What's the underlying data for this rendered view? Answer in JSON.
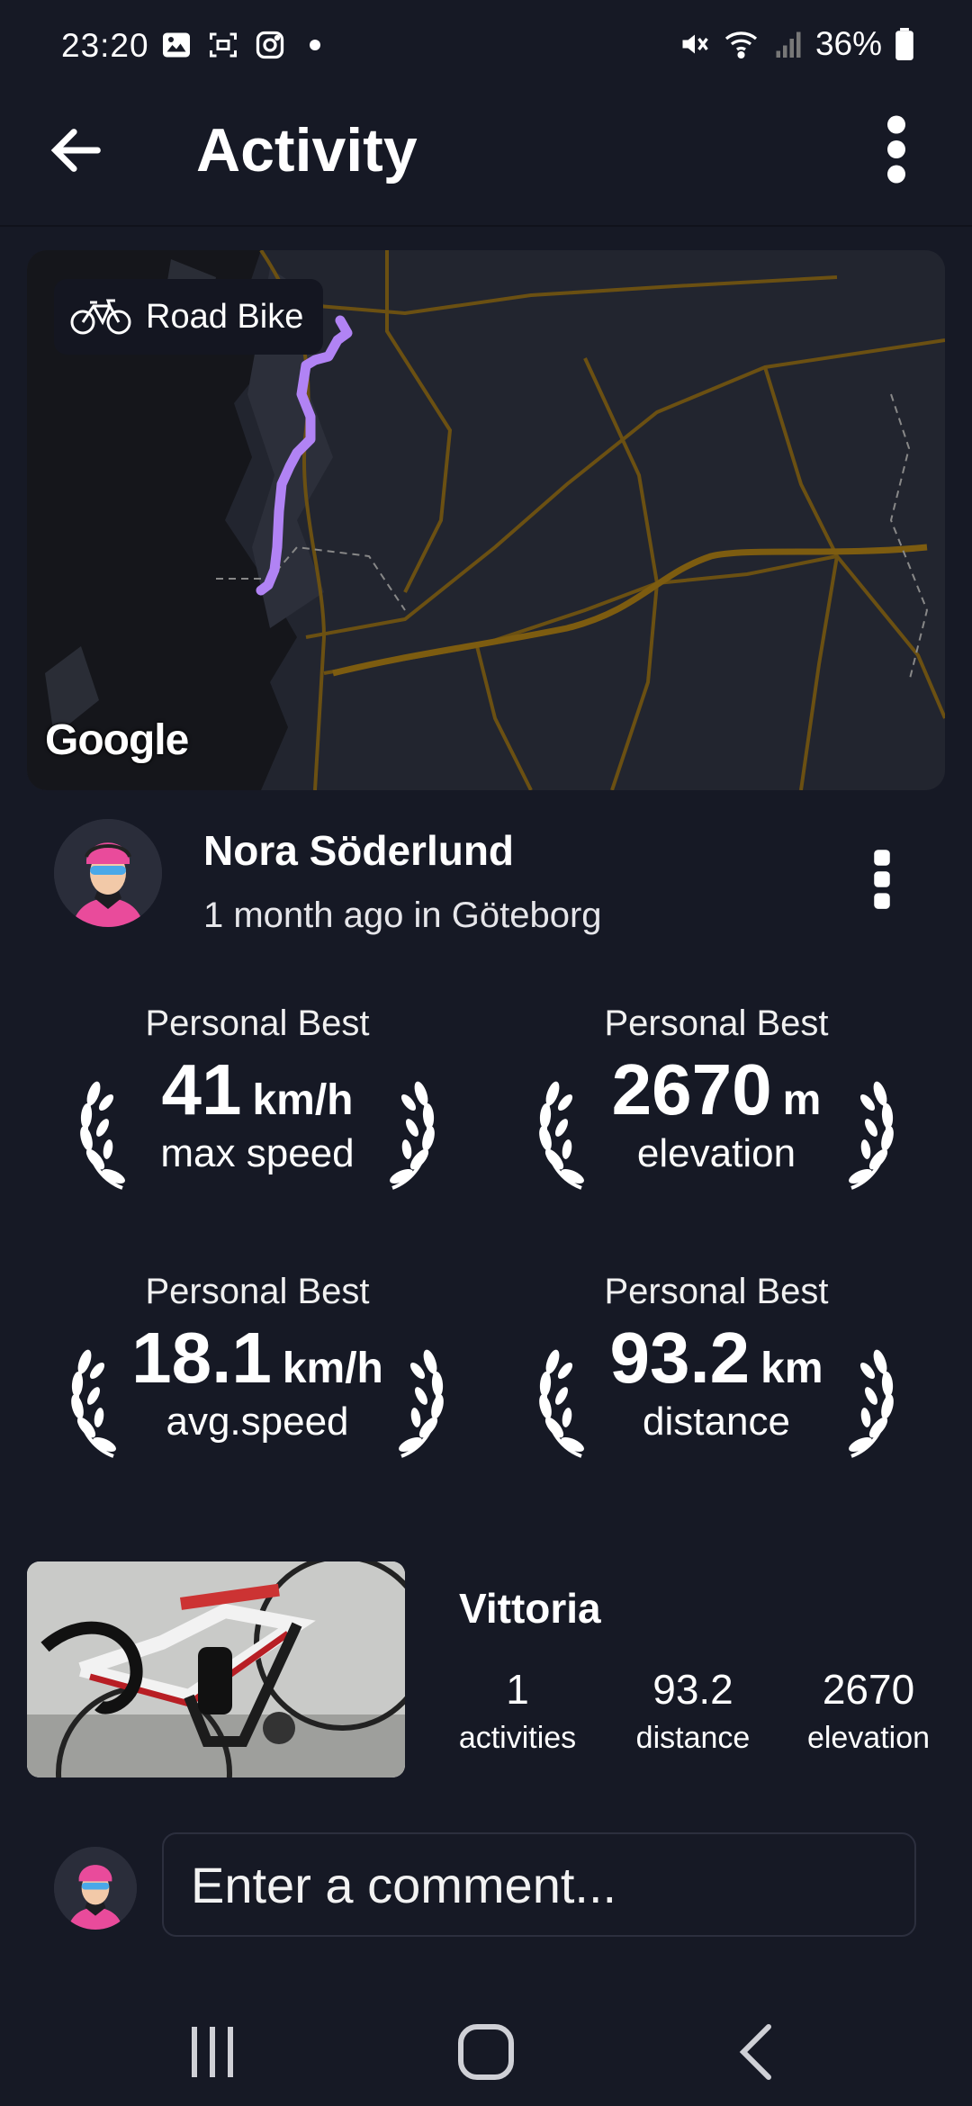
{
  "status": {
    "time": "23:20",
    "battery": "36%"
  },
  "appbar": {
    "title": "Activity"
  },
  "map": {
    "activity_type": "Road Bike",
    "provider": "Google",
    "route_color": "#b183f4"
  },
  "user": {
    "name": "Nora Söderlund",
    "subtitle": "1 month ago in Göteborg"
  },
  "stats": [
    {
      "badge": "Personal Best",
      "value": "41",
      "unit": "km/h",
      "label": "max speed"
    },
    {
      "badge": "Personal Best",
      "value": "2670",
      "unit": "m",
      "label": "elevation"
    },
    {
      "badge": "Personal Best",
      "value": "18.1",
      "unit": "km/h",
      "label": "avg.speed"
    },
    {
      "badge": "Personal Best",
      "value": "93.2",
      "unit": "km",
      "label": "distance"
    }
  ],
  "bike": {
    "name": "Vittoria",
    "stats": [
      {
        "value": "1",
        "label": "activities"
      },
      {
        "value": "93.2",
        "label": "distance"
      },
      {
        "value": "2670",
        "label": "elevation"
      }
    ]
  },
  "comment": {
    "placeholder": "Enter a comment..."
  },
  "icons": {
    "back": "arrow-left-icon",
    "menu": "more-vert-icon",
    "bike": "bicycle-icon",
    "laurel": "laurel-wreath-icon",
    "nav_recent": "recent-apps-icon",
    "nav_home": "home-icon",
    "nav_back": "nav-back-icon"
  }
}
